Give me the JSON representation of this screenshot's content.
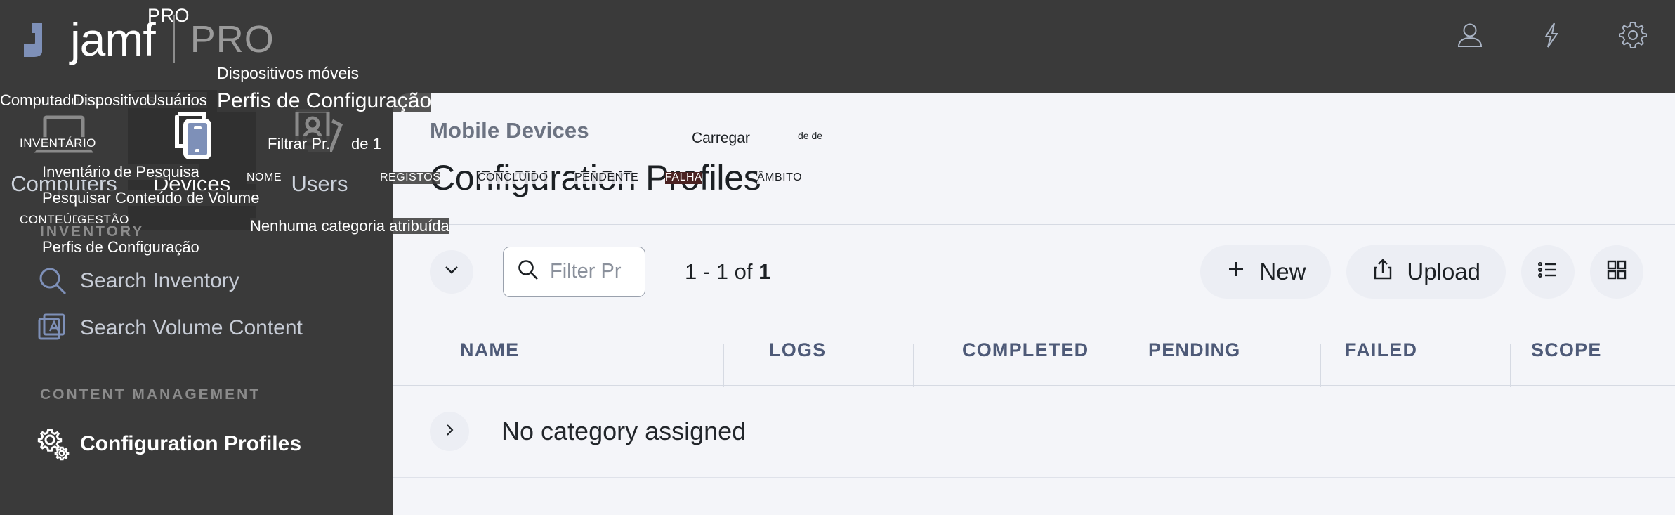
{
  "app": {
    "brand_name": "jamf",
    "brand_pro_small": "PRO",
    "brand_pro_large": "PRO"
  },
  "topbar": {
    "icons": [
      {
        "name": "user-account-icon",
        "label": "Account"
      },
      {
        "name": "lightning-bolt-icon",
        "label": "Quick Actions"
      },
      {
        "name": "gear-settings-icon",
        "label": "Settings"
      }
    ]
  },
  "nav_tabs": [
    {
      "label": "Computers",
      "icon": "laptop-icon",
      "active": false
    },
    {
      "label": "Devices",
      "icon": "mobile-device-icon",
      "active": true
    },
    {
      "label": "Users",
      "icon": "user-cards-icon",
      "active": false
    }
  ],
  "sidebar": {
    "sections": [
      {
        "title": "INVENTORY",
        "items": [
          {
            "label": "Search Inventory",
            "icon": "magnifier-icon",
            "current": false
          },
          {
            "label": "Search Volume Content",
            "icon": "app-store-stack-icon",
            "current": false
          }
        ]
      },
      {
        "title": "CONTENT MANAGEMENT",
        "items": [
          {
            "label": "Configuration Profiles",
            "icon": "gears-icon",
            "current": true
          }
        ]
      }
    ]
  },
  "panel": {
    "eyebrow": "Mobile Devices",
    "title": "Configuration Profiles"
  },
  "toolbar": {
    "collapse_icon": "chevron-down-icon",
    "filter_placeholder": "Filter Pr",
    "count_prefix": "1 - 1 of ",
    "count_total": "1",
    "new_label": "New",
    "new_icon": "plus-icon",
    "upload_label": "Upload",
    "upload_icon": "upload-share-icon",
    "list_view_icon": "list-view-icon",
    "grid_view_icon": "grid-view-icon"
  },
  "table": {
    "columns": [
      "NAME",
      "LOGS",
      "COMPLETED",
      "PENDING",
      "FAILED",
      "SCOPE"
    ],
    "rows": [
      {
        "expand_icon": "chevron-right-icon",
        "name": "No category assigned"
      }
    ]
  },
  "translation_overlay": {
    "language": "pt-PT",
    "labels": {
      "mobile_devices": "Dispositivos móveis",
      "configuration_profiles_title": "Perfis de Configuração",
      "computers": "Computadores",
      "devices": "Dispositivos",
      "users": "Usuários",
      "inventory_section": "INVENTÁRIO",
      "search_inventory": "Inventário de Pesquisa",
      "search_volume_content": "Pesquisar Conteúdo de Volume",
      "content_section": "CONTEÚDO",
      "management_section": "GESTÃO",
      "configuration_profiles_side": "Perfis de Configuração",
      "filter_placeholder": "Filtrar Pr.",
      "of_one": "de 1",
      "col_name": "NOME",
      "col_logs": "REGISTOS",
      "col_completed": "CONCLUÍDO",
      "col_pending": "PENDENTE",
      "col_failed": "FALHA",
      "col_scope": "ÂMBITO",
      "no_category": "Nenhuma categoria atribuída",
      "upload": "Carregar",
      "view_toggle": "de de"
    }
  },
  "colors": {
    "shell_bg": "#3a3a3a",
    "tab_active_bg": "#303030",
    "panel_bg": "#f4f5f9",
    "accent_blue": "#7e90b8",
    "header_text": "#4e5a78",
    "muted_text": "#8b8b8b"
  }
}
